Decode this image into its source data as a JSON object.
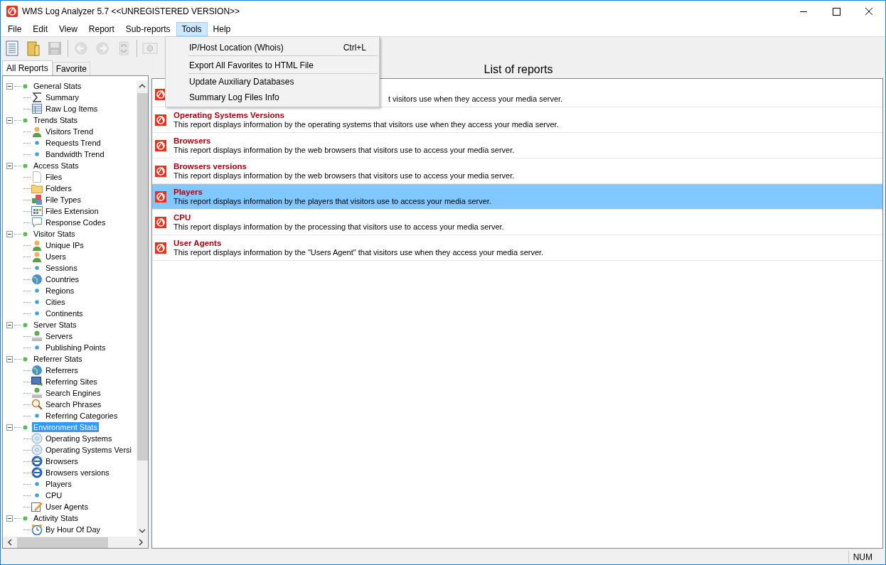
{
  "window": {
    "title": "WMS Log Analyzer 5.7 <<UNREGISTERED VERSION>>"
  },
  "menu": [
    {
      "label": "File",
      "selected": false
    },
    {
      "label": "Edit",
      "selected": false
    },
    {
      "label": "View",
      "selected": false
    },
    {
      "label": "Report",
      "selected": false
    },
    {
      "label": "Sub-reports",
      "selected": false
    },
    {
      "label": "Tools",
      "selected": true
    },
    {
      "label": "Help",
      "selected": false
    }
  ],
  "tools_menu": [
    {
      "label": "IP/Host Location (Whois)",
      "shortcut": "Ctrl+L",
      "separator_after": true
    },
    {
      "label": "Export All Favorites to HTML File",
      "separator_after": true
    },
    {
      "label": "Update Auxiliary Databases",
      "separator_after": false
    },
    {
      "label": "Summary Log Files Info",
      "separator_after": false
    }
  ],
  "toolbar": [
    {
      "kind": "doc",
      "disabled": false
    },
    {
      "kind": "folder",
      "disabled": false
    },
    {
      "kind": "save",
      "disabled": true
    },
    {
      "kind": "sep"
    },
    {
      "kind": "back",
      "disabled": true
    },
    {
      "kind": "forward",
      "disabled": true
    },
    {
      "kind": "refresh",
      "disabled": true
    },
    {
      "kind": "sep"
    },
    {
      "kind": "camera",
      "disabled": true
    }
  ],
  "tabs": [
    {
      "label": "All Reports",
      "selected": true
    },
    {
      "label": "Favorite",
      "selected": false
    }
  ],
  "tree": [
    {
      "label": "General Stats",
      "expanded": true,
      "selected": false,
      "children": [
        {
          "label": "Summary",
          "kind": "sigma"
        },
        {
          "label": "Raw Log Items",
          "kind": "table"
        }
      ]
    },
    {
      "label": "Trends Stats",
      "expanded": true,
      "selected": false,
      "children": [
        {
          "label": "Visitors Trend",
          "kind": "person"
        },
        {
          "label": "Requests Trend",
          "kind": "dot"
        },
        {
          "label": "Bandwidth Trend",
          "kind": "dot"
        }
      ]
    },
    {
      "label": "Access Stats",
      "expanded": true,
      "selected": false,
      "children": [
        {
          "label": "Files",
          "kind": "file"
        },
        {
          "label": "Folders",
          "kind": "folder"
        },
        {
          "label": "File Types",
          "kind": "cubes"
        },
        {
          "label": "Files Extension",
          "kind": "grid"
        },
        {
          "label": "Response Codes",
          "kind": "speech"
        }
      ]
    },
    {
      "label": "Visitor Stats",
      "expanded": true,
      "selected": false,
      "children": [
        {
          "label": "Unique IPs",
          "kind": "person"
        },
        {
          "label": "Users",
          "kind": "person"
        },
        {
          "label": "Sessions",
          "kind": "dot"
        },
        {
          "label": "Countries",
          "kind": "globe"
        },
        {
          "label": "Regions",
          "kind": "dot"
        },
        {
          "label": "Cities",
          "kind": "dot"
        },
        {
          "label": "Continents",
          "kind": "dot"
        }
      ]
    },
    {
      "label": "Server Stats",
      "expanded": true,
      "selected": false,
      "children": [
        {
          "label": "Servers",
          "kind": "server"
        },
        {
          "label": "Publishing Points",
          "kind": "dot"
        }
      ]
    },
    {
      "label": "Referrer Stats",
      "expanded": true,
      "selected": false,
      "children": [
        {
          "label": "Referrers",
          "kind": "globe"
        },
        {
          "label": "Referring Sites",
          "kind": "monitor"
        },
        {
          "label": "Search Engines",
          "kind": "server"
        },
        {
          "label": "Search Phrases",
          "kind": "magnifier"
        },
        {
          "label": "Referring Categories",
          "kind": "dot"
        }
      ]
    },
    {
      "label": "Environment Stats",
      "expanded": true,
      "selected": true,
      "children": [
        {
          "label": "Operating Systems",
          "kind": "disc"
        },
        {
          "label": "Operating Systems Versi",
          "kind": "disc"
        },
        {
          "label": "Browsers",
          "kind": "browser"
        },
        {
          "label": "Browsers versions",
          "kind": "browser"
        },
        {
          "label": "Players",
          "kind": "dot"
        },
        {
          "label": "CPU",
          "kind": "dot"
        },
        {
          "label": "User Agents",
          "kind": "edit"
        }
      ]
    },
    {
      "label": "Activity Stats",
      "expanded": true,
      "selected": false,
      "children": [
        {
          "label": "By Hour Of Day",
          "kind": "clock"
        }
      ]
    }
  ],
  "list_header": "List of reports",
  "reports": [
    {
      "description": "t visitors use when they access your media server.",
      "selected": false,
      "covered": true
    },
    {
      "title": "Operating Systems Versions",
      "description": "This report displays information by the operating systems that visitors use when they access your media server.",
      "selected": false
    },
    {
      "title": "Browsers",
      "description": "This report displays information by the web browsers that visitors use to access your media server.",
      "selected": false
    },
    {
      "title": "Browsers versions",
      "description": "This report displays information by the web browsers that visitors use to access your media server.",
      "selected": false
    },
    {
      "title": "Players",
      "description": "This report displays information by the players that visitors use to access your media server.",
      "selected": true
    },
    {
      "title": "CPU",
      "description": "This report displays information by the processing that visitors use to access your media server.",
      "selected": false
    },
    {
      "title": "User Agents",
      "description": "This report displays information by the \"Users Agent\" that visitors use when they access your media server.",
      "selected": false
    }
  ],
  "status_bar": {
    "num": "NUM"
  }
}
